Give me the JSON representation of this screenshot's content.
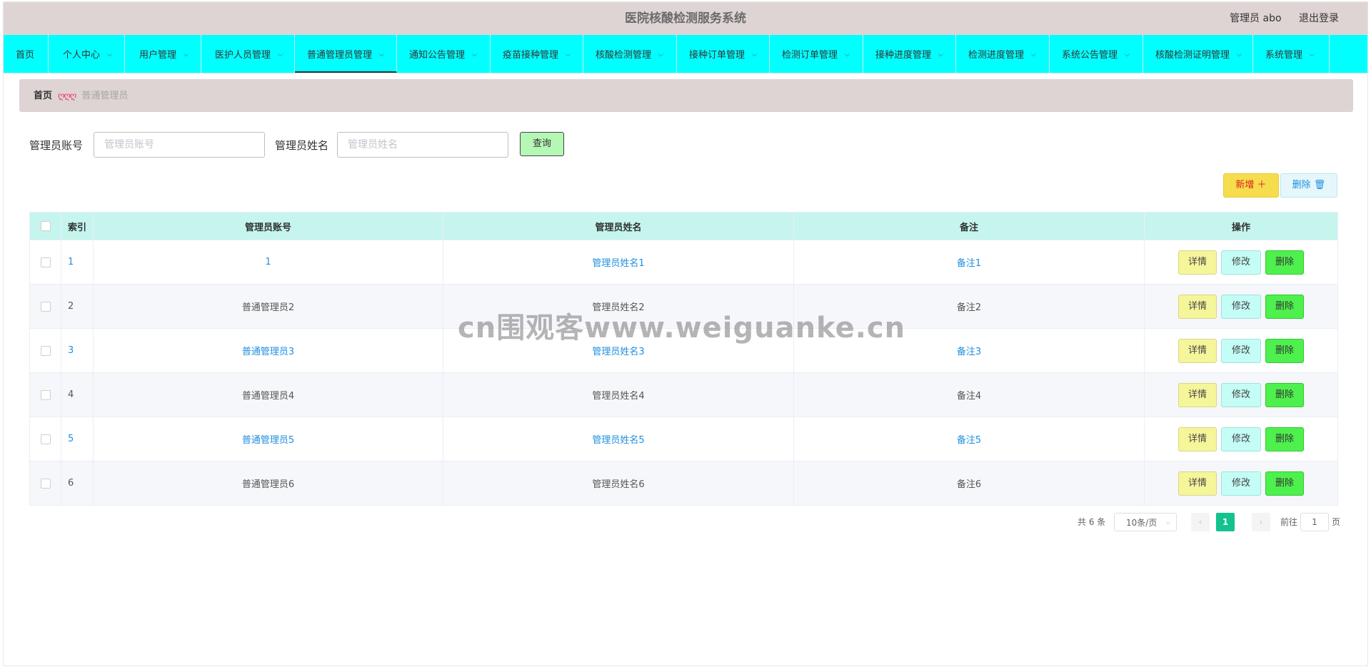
{
  "header": {
    "title": "医院核酸检测服务系统",
    "user_label": "管理员 abo",
    "logout_label": "退出登录"
  },
  "nav": {
    "items": [
      {
        "label": "首页",
        "has_dropdown": false
      },
      {
        "label": "个人中心",
        "has_dropdown": true
      },
      {
        "label": "用户管理",
        "has_dropdown": true
      },
      {
        "label": "医护人员管理",
        "has_dropdown": true
      },
      {
        "label": "普通管理员管理",
        "has_dropdown": true,
        "active": true
      },
      {
        "label": "通知公告管理",
        "has_dropdown": true
      },
      {
        "label": "疫苗接种管理",
        "has_dropdown": true
      },
      {
        "label": "核酸检测管理",
        "has_dropdown": true
      },
      {
        "label": "接种订单管理",
        "has_dropdown": true
      },
      {
        "label": "检测订单管理",
        "has_dropdown": true
      },
      {
        "label": "接种进度管理",
        "has_dropdown": true
      },
      {
        "label": "检测进度管理",
        "has_dropdown": true
      },
      {
        "label": "系统公告管理",
        "has_dropdown": true
      },
      {
        "label": "核酸检测证明管理",
        "has_dropdown": true
      },
      {
        "label": "系统管理",
        "has_dropdown": true
      }
    ],
    "chevron": "⌵"
  },
  "breadcrumb": {
    "home": "首页",
    "separator": "ღღღ",
    "current": "普通管理员"
  },
  "search": {
    "account_label": "管理员账号",
    "account_placeholder": "管理员账号",
    "name_label": "管理员姓名",
    "name_placeholder": "管理员姓名",
    "query_label": "查询"
  },
  "actions": {
    "add_label": "新增 ＋",
    "delete_label": "删除 🗑"
  },
  "table": {
    "headers": {
      "index": "索引",
      "account": "管理员账号",
      "name": "管理员姓名",
      "remark": "备注",
      "ops": "操作"
    },
    "rows": [
      {
        "index": "1",
        "account": "1",
        "name": "管理员姓名1",
        "remark": "备注1"
      },
      {
        "index": "2",
        "account": "普通管理员2",
        "name": "管理员姓名2",
        "remark": "备注2"
      },
      {
        "index": "3",
        "account": "普通管理员3",
        "name": "管理员姓名3",
        "remark": "备注3"
      },
      {
        "index": "4",
        "account": "普通管理员4",
        "name": "管理员姓名4",
        "remark": "备注4"
      },
      {
        "index": "5",
        "account": "普通管理员5",
        "name": "管理员姓名5",
        "remark": "备注5"
      },
      {
        "index": "6",
        "account": "普通管理员6",
        "name": "管理员姓名6",
        "remark": "备注6"
      }
    ],
    "op_labels": {
      "detail": "详情",
      "edit": "修改",
      "remove": "删除"
    }
  },
  "pagination": {
    "total": "共 6 条",
    "page_size": "10条/页",
    "prev": "‹",
    "current": "1",
    "next": "›",
    "goto_label": "前往",
    "goto_value": "1",
    "page_unit": "页"
  },
  "watermark": "cn围观客www.weiguanke.cn",
  "colors": {
    "header_bg": "#dfd4d4",
    "nav_bg": "#00ffff",
    "table_header_bg": "#c6f5ee",
    "link": "#1f8fe0",
    "add_btn": "#f5dd4d",
    "detail_btn": "#f5f59a",
    "edit_btn": "#c4fdf6",
    "remove_btn": "#4ef04e",
    "page_active": "#13c28f"
  }
}
